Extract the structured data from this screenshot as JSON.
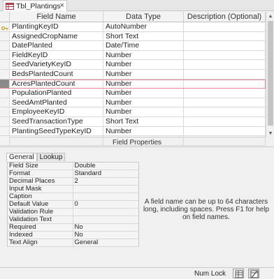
{
  "tab": {
    "title": "Tbl_Plantings",
    "close": "×"
  },
  "grid": {
    "headers": {
      "name": "Field Name",
      "type": "Data Type",
      "desc": "Description (Optional)"
    },
    "rows": [
      {
        "name": "PlantingKeyID",
        "type": "AutoNumber",
        "desc": ""
      },
      {
        "name": "AssignedCropName",
        "type": "Short Text",
        "desc": ""
      },
      {
        "name": "DatePlanted",
        "type": "Date/Time",
        "desc": ""
      },
      {
        "name": "FieldKeyID",
        "type": "Number",
        "desc": ""
      },
      {
        "name": "SeedVarietyKeyID",
        "type": "Number",
        "desc": ""
      },
      {
        "name": "BedsPlantedCount",
        "type": "Number",
        "desc": ""
      },
      {
        "name": "AcresPlantedCount",
        "type": "Number",
        "desc": ""
      },
      {
        "name": "PopulationPlanted",
        "type": "Number",
        "desc": ""
      },
      {
        "name": "SeedAmtPlanted",
        "type": "Number",
        "desc": ""
      },
      {
        "name": "EmployeeKeyID",
        "type": "Number",
        "desc": ""
      },
      {
        "name": "SeedTransactionType",
        "type": "Short Text",
        "desc": ""
      },
      {
        "name": "PlantingSeedTypeKeyID",
        "type": "Number",
        "desc": ""
      },
      {
        "name": "",
        "type": "",
        "desc": ""
      }
    ]
  },
  "field_properties_label": "Field Properties",
  "prop_tabs": {
    "general": "General",
    "lookup": "Lookup"
  },
  "properties": [
    {
      "name": "Field Size",
      "value": "Double"
    },
    {
      "name": "Format",
      "value": "Standard"
    },
    {
      "name": "Decimal Places",
      "value": "2"
    },
    {
      "name": "Input Mask",
      "value": ""
    },
    {
      "name": "Caption",
      "value": ""
    },
    {
      "name": "Default Value",
      "value": "0"
    },
    {
      "name": "Validation Rule",
      "value": ""
    },
    {
      "name": "Validation Text",
      "value": ""
    },
    {
      "name": "Required",
      "value": "No"
    },
    {
      "name": "Indexed",
      "value": "No"
    },
    {
      "name": "Text Align",
      "value": "General"
    }
  ],
  "help_text": "A field name can be up to 64 characters long, including spaces. Press F1 for help on field names.",
  "status": {
    "numlock": "Num Lock"
  }
}
